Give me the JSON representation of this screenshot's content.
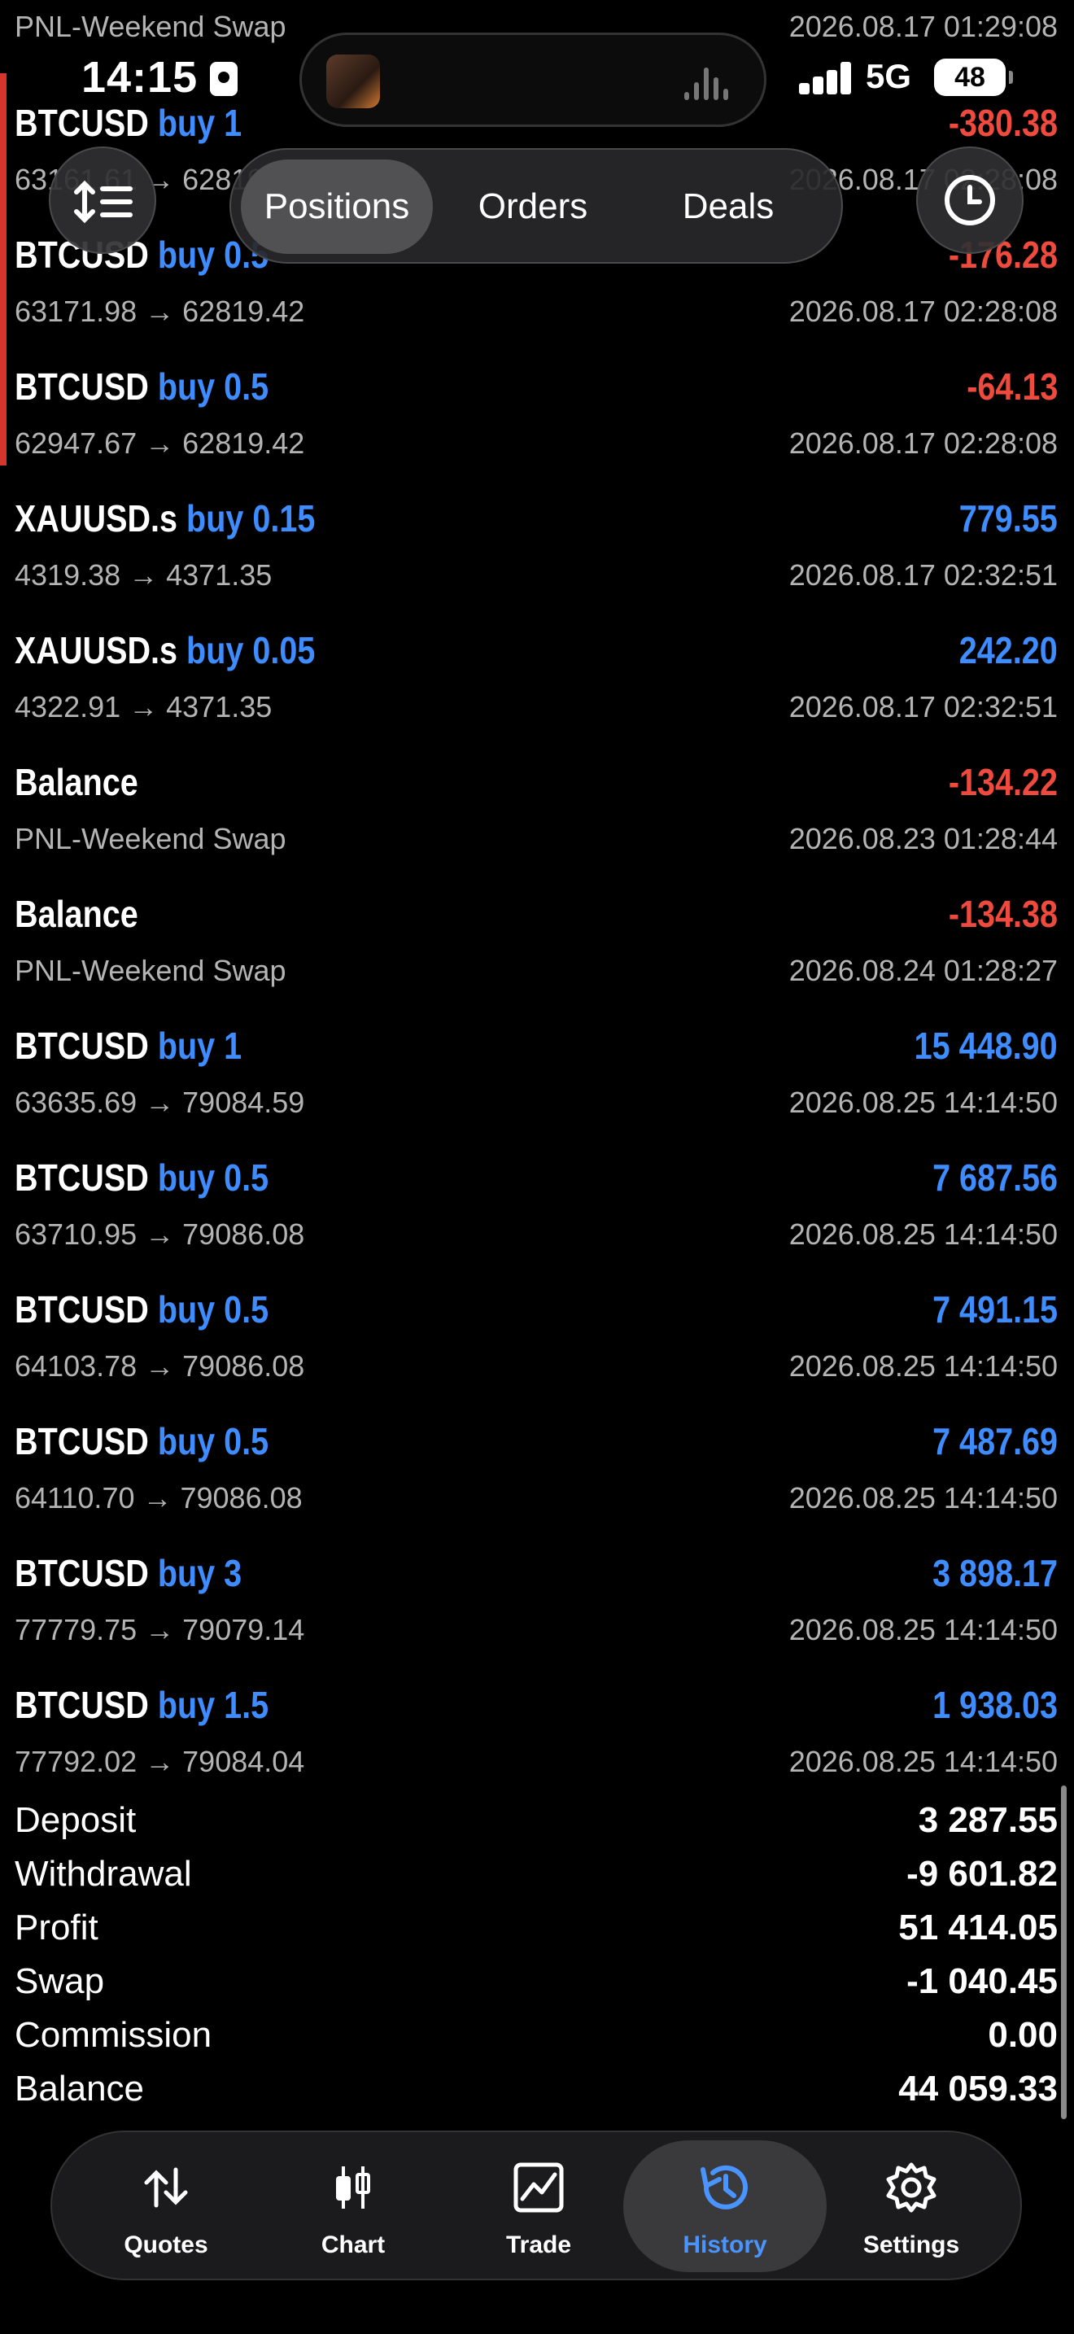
{
  "status": {
    "time": "14:15",
    "network": "5G",
    "battery": "48"
  },
  "toolbar": {
    "tabs": [
      "Positions",
      "Orders",
      "Deals"
    ],
    "active_tab": "Positions"
  },
  "partial_rows": {
    "top_left": "PNL-Weekend Swap",
    "top_right": "2026.08.17 01:29:08",
    "second_symbol": "BTCUSD",
    "second_type": "buy 1",
    "second_profit": "-380.38",
    "second_prices": "63161.61 → 62819.42",
    "second_date": "2026.08.17 02:28:08"
  },
  "deals": [
    {
      "symbol": "BTCUSD",
      "type": "buy 0.5",
      "profit": "-176.28",
      "prices": "63171.98 → 62819.42",
      "date": "2026.08.17 02:28:08",
      "sign": "neg"
    },
    {
      "symbol": "BTCUSD",
      "type": "buy 0.5",
      "profit": "-64.13",
      "prices": "62947.67 → 62819.42",
      "date": "2026.08.17 02:28:08",
      "sign": "neg"
    },
    {
      "symbol": "XAUUSD.s",
      "type": "buy 0.15",
      "profit": "779.55",
      "prices": "4319.38 → 4371.35",
      "date": "2026.08.17 02:32:51",
      "sign": "pos"
    },
    {
      "symbol": "XAUUSD.s",
      "type": "buy 0.05",
      "profit": "242.20",
      "prices": "4322.91 → 4371.35",
      "date": "2026.08.17 02:32:51",
      "sign": "pos"
    },
    {
      "symbol": "Balance",
      "type": "",
      "profit": "-134.22",
      "prices": "PNL-Weekend Swap",
      "date": "2026.08.23 01:28:44",
      "sign": "neg"
    },
    {
      "symbol": "Balance",
      "type": "",
      "profit": "-134.38",
      "prices": "PNL-Weekend Swap",
      "date": "2026.08.24 01:28:27",
      "sign": "neg"
    },
    {
      "symbol": "BTCUSD",
      "type": "buy 1",
      "profit": "15 448.90",
      "prices": "63635.69 → 79084.59",
      "date": "2026.08.25 14:14:50",
      "sign": "pos"
    },
    {
      "symbol": "BTCUSD",
      "type": "buy 0.5",
      "profit": "7 687.56",
      "prices": "63710.95 → 79086.08",
      "date": "2026.08.25 14:14:50",
      "sign": "pos"
    },
    {
      "symbol": "BTCUSD",
      "type": "buy 0.5",
      "profit": "7 491.15",
      "prices": "64103.78 → 79086.08",
      "date": "2026.08.25 14:14:50",
      "sign": "pos"
    },
    {
      "symbol": "BTCUSD",
      "type": "buy 0.5",
      "profit": "7 487.69",
      "prices": "64110.70 → 79086.08",
      "date": "2026.08.25 14:14:50",
      "sign": "pos"
    },
    {
      "symbol": "BTCUSD",
      "type": "buy 3",
      "profit": "3 898.17",
      "prices": "77779.75 → 79079.14",
      "date": "2026.08.25 14:14:50",
      "sign": "pos"
    },
    {
      "symbol": "BTCUSD",
      "type": "buy 1.5",
      "profit": "1 938.03",
      "prices": "77792.02 → 79084.04",
      "date": "2026.08.25 14:14:50",
      "sign": "pos"
    }
  ],
  "summary": [
    {
      "label": "Deposit",
      "value": "3 287.55"
    },
    {
      "label": "Withdrawal",
      "value": "-9 601.82"
    },
    {
      "label": "Profit",
      "value": "51 414.05"
    },
    {
      "label": "Swap",
      "value": "-1 040.45"
    },
    {
      "label": "Commission",
      "value": "0.00"
    },
    {
      "label": "Balance",
      "value": "44 059.33"
    }
  ],
  "tabbar": {
    "items": [
      {
        "label": "Quotes",
        "icon": "quotes-arrows-icon"
      },
      {
        "label": "Chart",
        "icon": "candlestick-icon"
      },
      {
        "label": "Trade",
        "icon": "trade-chart-icon"
      },
      {
        "label": "History",
        "icon": "history-clock-icon"
      },
      {
        "label": "Settings",
        "icon": "gear-icon"
      }
    ],
    "active": "History"
  },
  "colors": {
    "positive": "#3f8cff",
    "negative": "#ef4a3e",
    "accent": "#4a94ff"
  }
}
